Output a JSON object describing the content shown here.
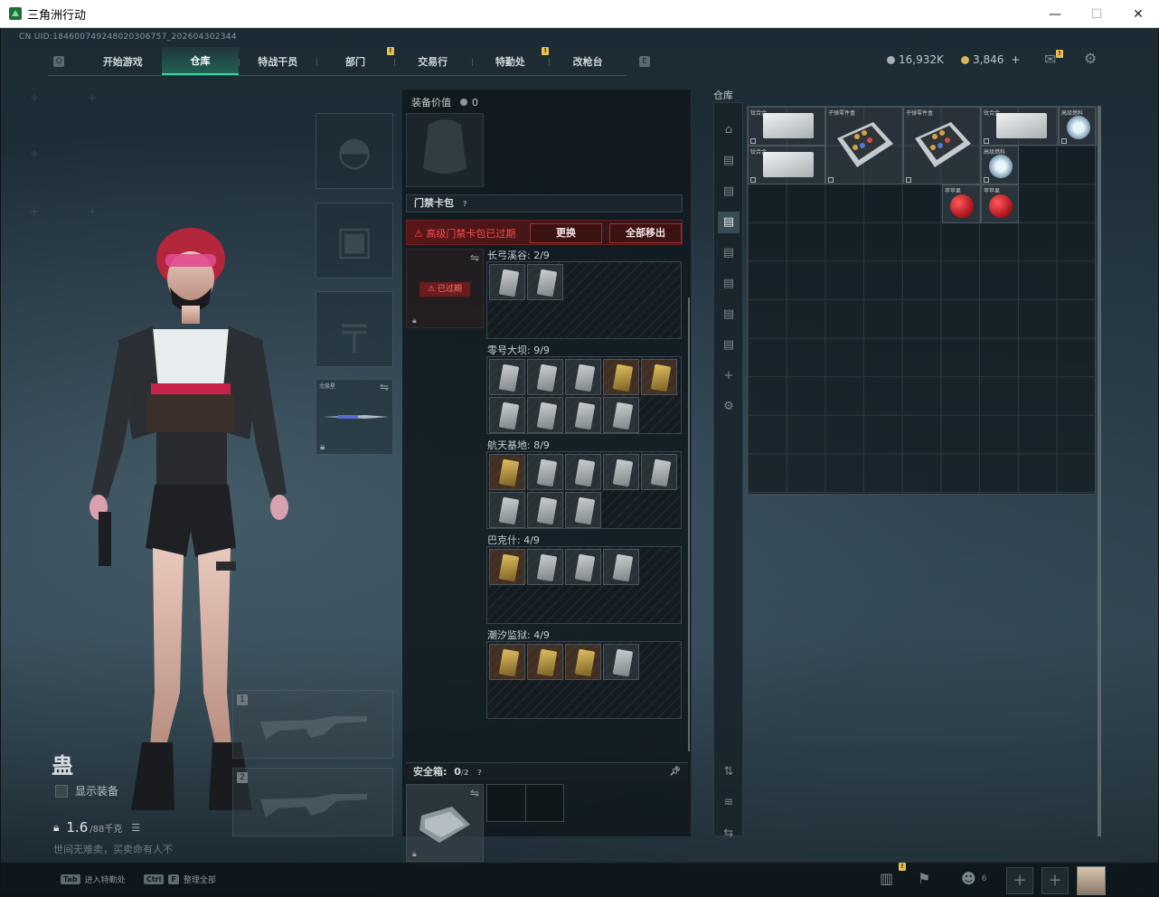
{
  "window": {
    "title": "三角洲行动",
    "controls": {
      "minimize": "—",
      "maximize": "☐",
      "close": "✕"
    }
  },
  "uid": "CN UID:18460074924802030​6757_202604302344",
  "nav": {
    "tabs": [
      {
        "label": "开始游戏",
        "active": false,
        "badge": ""
      },
      {
        "label": "仓库",
        "active": true,
        "badge": ""
      },
      {
        "label": "特战干员",
        "active": false,
        "badge": ""
      },
      {
        "label": "部门",
        "active": false,
        "badge": "!"
      },
      {
        "label": "交易行",
        "active": false,
        "badge": ""
      },
      {
        "label": "特勤处",
        "active": false,
        "badge": "!"
      },
      {
        "label": "改枪台",
        "active": false,
        "badge": ""
      }
    ]
  },
  "currency": {
    "hafcoin": "16,932K",
    "trilogy_coin": "3,846",
    "add_symbol": "+"
  },
  "character": {
    "name": "蛊",
    "show_equipment_label": "显示装备",
    "weight_value": "1.6",
    "weight_max": "/88千克",
    "motto": "世间无难卖，买卖命有人不"
  },
  "equipment": {
    "melee_label": "北极星"
  },
  "middle": {
    "gear_value_label": "装备价值",
    "gear_value": "0",
    "keycase_title": "门禁卡包",
    "keycase_help": "?",
    "warning_text": "高级门禁卡包已过期",
    "replace_button": "更换",
    "remove_all_button": "全部移出",
    "expired_tag": "已过期",
    "maps": [
      {
        "label": "长弓溪谷: 2/9",
        "cards": [
          [
            "",
            ""
          ],
          [
            "",
            ""
          ]
        ]
      },
      {
        "label": "零号大坝: 9/9",
        "cards": [
          [
            "",
            ""
          ]
        ]
      },
      {
        "label": "航天基地: 8/9",
        "cards": [
          [
            "",
            ""
          ]
        ]
      },
      {
        "label": "巴克什: 4/9",
        "cards": [
          [
            "",
            ""
          ]
        ]
      },
      {
        "label": "潮汐监狱: 4/9",
        "cards": [
          [
            "",
            ""
          ]
        ]
      }
    ],
    "safebox_label": "安全箱:",
    "safebox_count": "0",
    "safebox_max": "/2",
    "safebox_help": "?"
  },
  "warehouse": {
    "title": "仓库",
    "items": [
      {
        "name": "钛合金"
      },
      {
        "name": "钛合金"
      },
      {
        "name": "子弹零件盒"
      },
      {
        "name": "子弹零件盒"
      },
      {
        "name": "钛合金"
      },
      {
        "name": "高级燃料"
      },
      {
        "name": "高级燃料"
      },
      {
        "name": "苹苹果"
      },
      {
        "name": "苹苹果"
      }
    ]
  },
  "bottom": {
    "hint1_key": "Tab",
    "hint1_label": "进入特勤处",
    "hint2_key1": "Ctrl",
    "hint2_key2": "F",
    "hint2_label": "整理全部",
    "friends_count": "6",
    "stats_badge": "!"
  },
  "icons": {
    "mail": "mail-icon",
    "settings": "gear-icon",
    "stats": "stats-icon",
    "flag": "flag-icon",
    "friends": "friends-icon"
  }
}
